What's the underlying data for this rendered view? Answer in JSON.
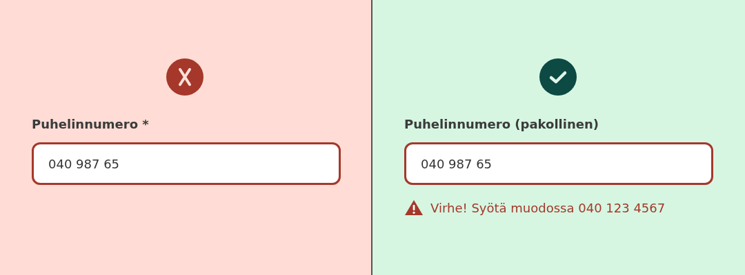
{
  "panels": [
    {
      "kind": "bad",
      "label": "Puhelinnumero *",
      "value": "040 987 65"
    },
    {
      "kind": "good",
      "label": "Puhelinnumero (pakollinen)",
      "value": "040 987 65",
      "error": "Virhe! Syötä muodossa 040 123 4567"
    }
  ]
}
